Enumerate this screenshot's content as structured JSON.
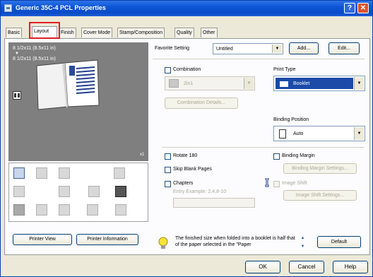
{
  "window": {
    "title": "Generic 35C-4 PCL Properties",
    "help_label": "?",
    "close_label": "✕"
  },
  "tabs": [
    {
      "label": "Basic"
    },
    {
      "label": "Layout"
    },
    {
      "label": "Finish"
    },
    {
      "label": "Cover Mode"
    },
    {
      "label": "Stamp/Composition"
    },
    {
      "label": "Quality"
    },
    {
      "label": "Other"
    }
  ],
  "preview": {
    "paper_line_1": "8 1/2x11 (8.5x11 in)",
    "arrow": "▼",
    "paper_line_2": "8 1/2x11 (8.5x11 in)",
    "zoom": "x1"
  },
  "favorite": {
    "label": "Favorite Setting",
    "value": "Untitled",
    "add_label": "Add...",
    "edit_label": "Edit..."
  },
  "combination": {
    "label": "Combination",
    "value": "2in1",
    "details_label": "Combination Details..."
  },
  "print_type": {
    "label": "Print Type",
    "value": "Booklet"
  },
  "binding_position": {
    "label": "Binding Position",
    "value": "Auto"
  },
  "options": {
    "rotate_label": "Rotate 180",
    "skip_blank_label": "Skip Blank Pages",
    "chapters_label": "Chapters",
    "chapters_example": "Entry Example: 2,4,8-10",
    "binding_margin_label": "Binding Margin",
    "binding_margin_settings_label": "Binding Margin Settings...",
    "image_shift_label": "Image Shift",
    "image_shift_settings_label": "Image Shift Settings..."
  },
  "left_buttons": {
    "printer_view": "Printer View",
    "printer_information": "Printer Information"
  },
  "notice": {
    "text": "The finished size when folded into a booklet is half that of the paper selected in the \"Paper"
  },
  "default_label": "Default",
  "footer": {
    "ok": "OK",
    "cancel": "Cancel",
    "help": "Help"
  },
  "colors": {
    "titlebar": "#0d55d6",
    "highlight": "#e12020",
    "selected_field": "#1b4aa8"
  }
}
